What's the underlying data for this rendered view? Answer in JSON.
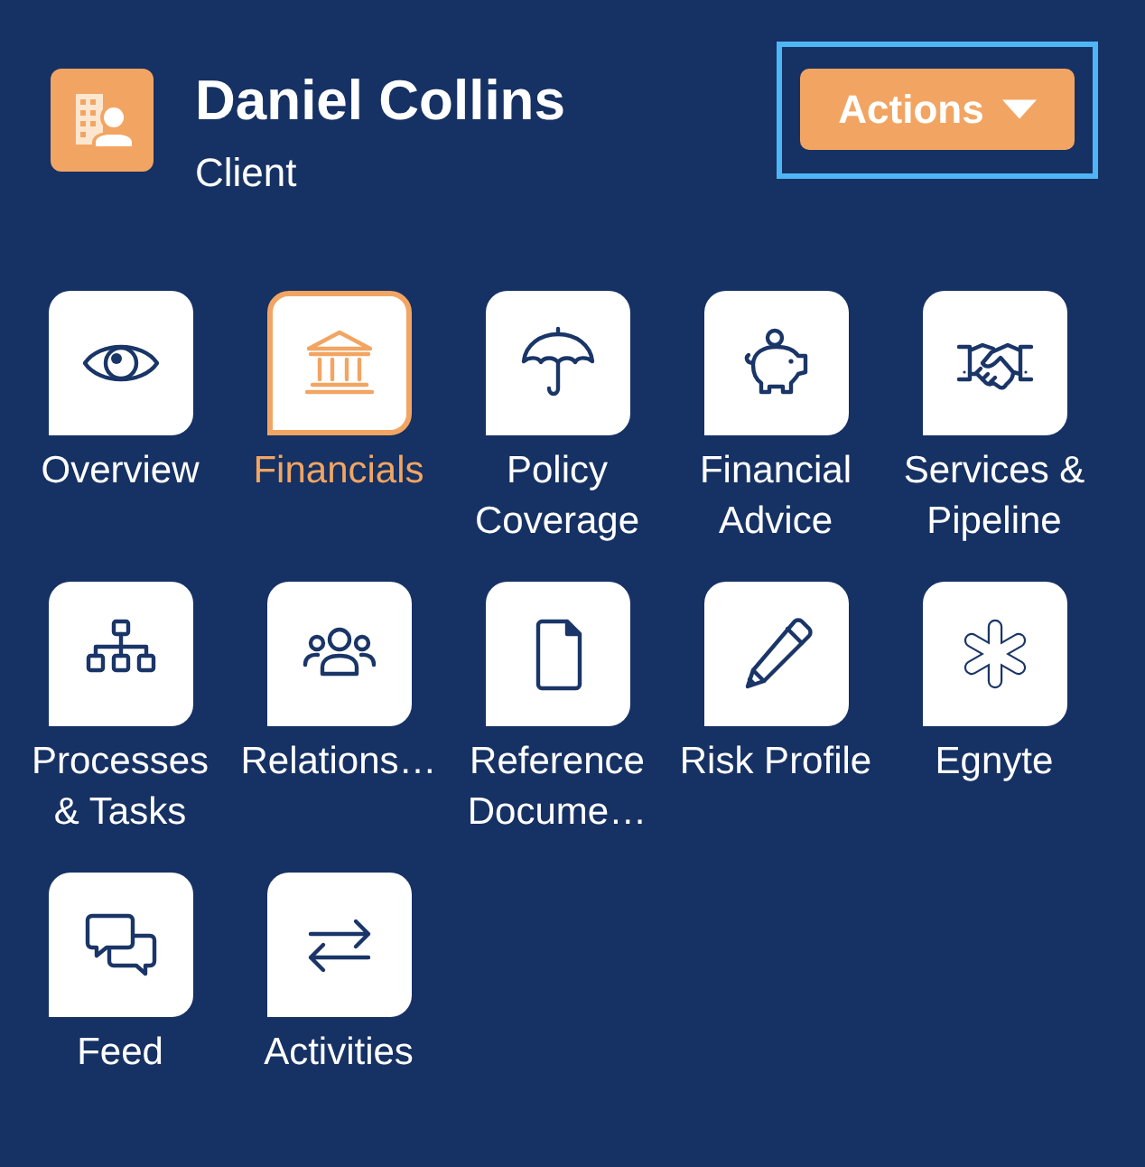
{
  "header": {
    "name": "Daniel Collins",
    "subtitle": "Client"
  },
  "actions_button": {
    "label": "Actions",
    "focused": true
  },
  "tiles": [
    {
      "label": "Overview",
      "kind": "eye",
      "selected": false
    },
    {
      "label": "Financials",
      "kind": "bank",
      "selected": true
    },
    {
      "label": "Policy Coverage",
      "kind": "umbrella",
      "selected": false
    },
    {
      "label": "Financial Advice",
      "kind": "piggy-bank",
      "selected": false
    },
    {
      "label": "Services & Pipeline",
      "kind": "handshake",
      "selected": false
    },
    {
      "label": "Processes & Tasks",
      "kind": "hierarchy",
      "selected": false
    },
    {
      "label": "Relations…",
      "kind": "people",
      "selected": false
    },
    {
      "label": "Reference Docume…",
      "kind": "document",
      "selected": false
    },
    {
      "label": "Risk Profile",
      "kind": "pencil",
      "selected": false
    },
    {
      "label": "Egnyte",
      "kind": "asterisk",
      "selected": false
    },
    {
      "label": "Feed",
      "kind": "chat",
      "selected": false
    },
    {
      "label": "Activities",
      "kind": "swap-arrows",
      "selected": false
    }
  ]
}
